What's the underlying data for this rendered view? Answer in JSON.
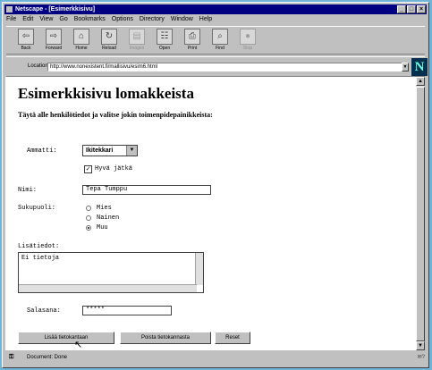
{
  "window": {
    "title": "Netscape - [Esimerkkisivu]"
  },
  "menu": [
    "File",
    "Edit",
    "View",
    "Go",
    "Bookmarks",
    "Options",
    "Directory",
    "Window",
    "Help"
  ],
  "toolbar": [
    {
      "label": "Back",
      "icon": "back-arrow-icon",
      "glyph": "⇦",
      "enabled": true
    },
    {
      "label": "Forward",
      "icon": "forward-arrow-icon",
      "glyph": "⇨",
      "enabled": true
    },
    {
      "label": "Home",
      "icon": "home-icon",
      "glyph": "⌂",
      "enabled": true
    },
    {
      "label": "Reload",
      "icon": "reload-icon",
      "glyph": "↻",
      "enabled": true
    },
    {
      "label": "Images",
      "icon": "images-icon",
      "glyph": "▤",
      "enabled": false
    },
    {
      "label": "Open",
      "icon": "open-icon",
      "glyph": "☷",
      "enabled": true
    },
    {
      "label": "Print",
      "icon": "print-icon",
      "glyph": "⎙",
      "enabled": true
    },
    {
      "label": "Find",
      "icon": "find-icon",
      "glyph": "⌕",
      "enabled": true
    },
    {
      "label": "Stop",
      "icon": "stop-icon",
      "glyph": "●",
      "enabled": false
    }
  ],
  "location": {
    "label": "Location:",
    "url": "http://www.nonexistent.fi/mallisivu/esim6.html"
  },
  "page": {
    "heading": "Esimerkkisivu lomakkeista",
    "subtitle": "Täytä alle henkilötiedot ja valitse jokin toimenpidepainikkeista:",
    "form": {
      "ammatti_label": "Ammatti:",
      "ammatti_value": "Ikitekkari",
      "checkbox_label": "Hyvä jätkä",
      "checkbox_checked": true,
      "nimi_label": "Nimi:",
      "nimi_value": "Tepa Tumppu",
      "sukupuoli_label": "Sukupuoli:",
      "sukupuoli_options": [
        {
          "label": "Mies",
          "selected": false
        },
        {
          "label": "Nainen",
          "selected": false
        },
        {
          "label": "Muu",
          "selected": true
        }
      ],
      "lisatiedot_label": "Lisätiedot:",
      "lisatiedot_value": "Ei tietoja",
      "salasana_label": "Salasana:",
      "salasana_value": "*****"
    },
    "buttons": {
      "add": "Lisää tietokantaan",
      "delete": "Poista tietokannasta",
      "reset": "Reset"
    }
  },
  "status": {
    "text": "Document: Done",
    "icon": "security-key-icon"
  }
}
